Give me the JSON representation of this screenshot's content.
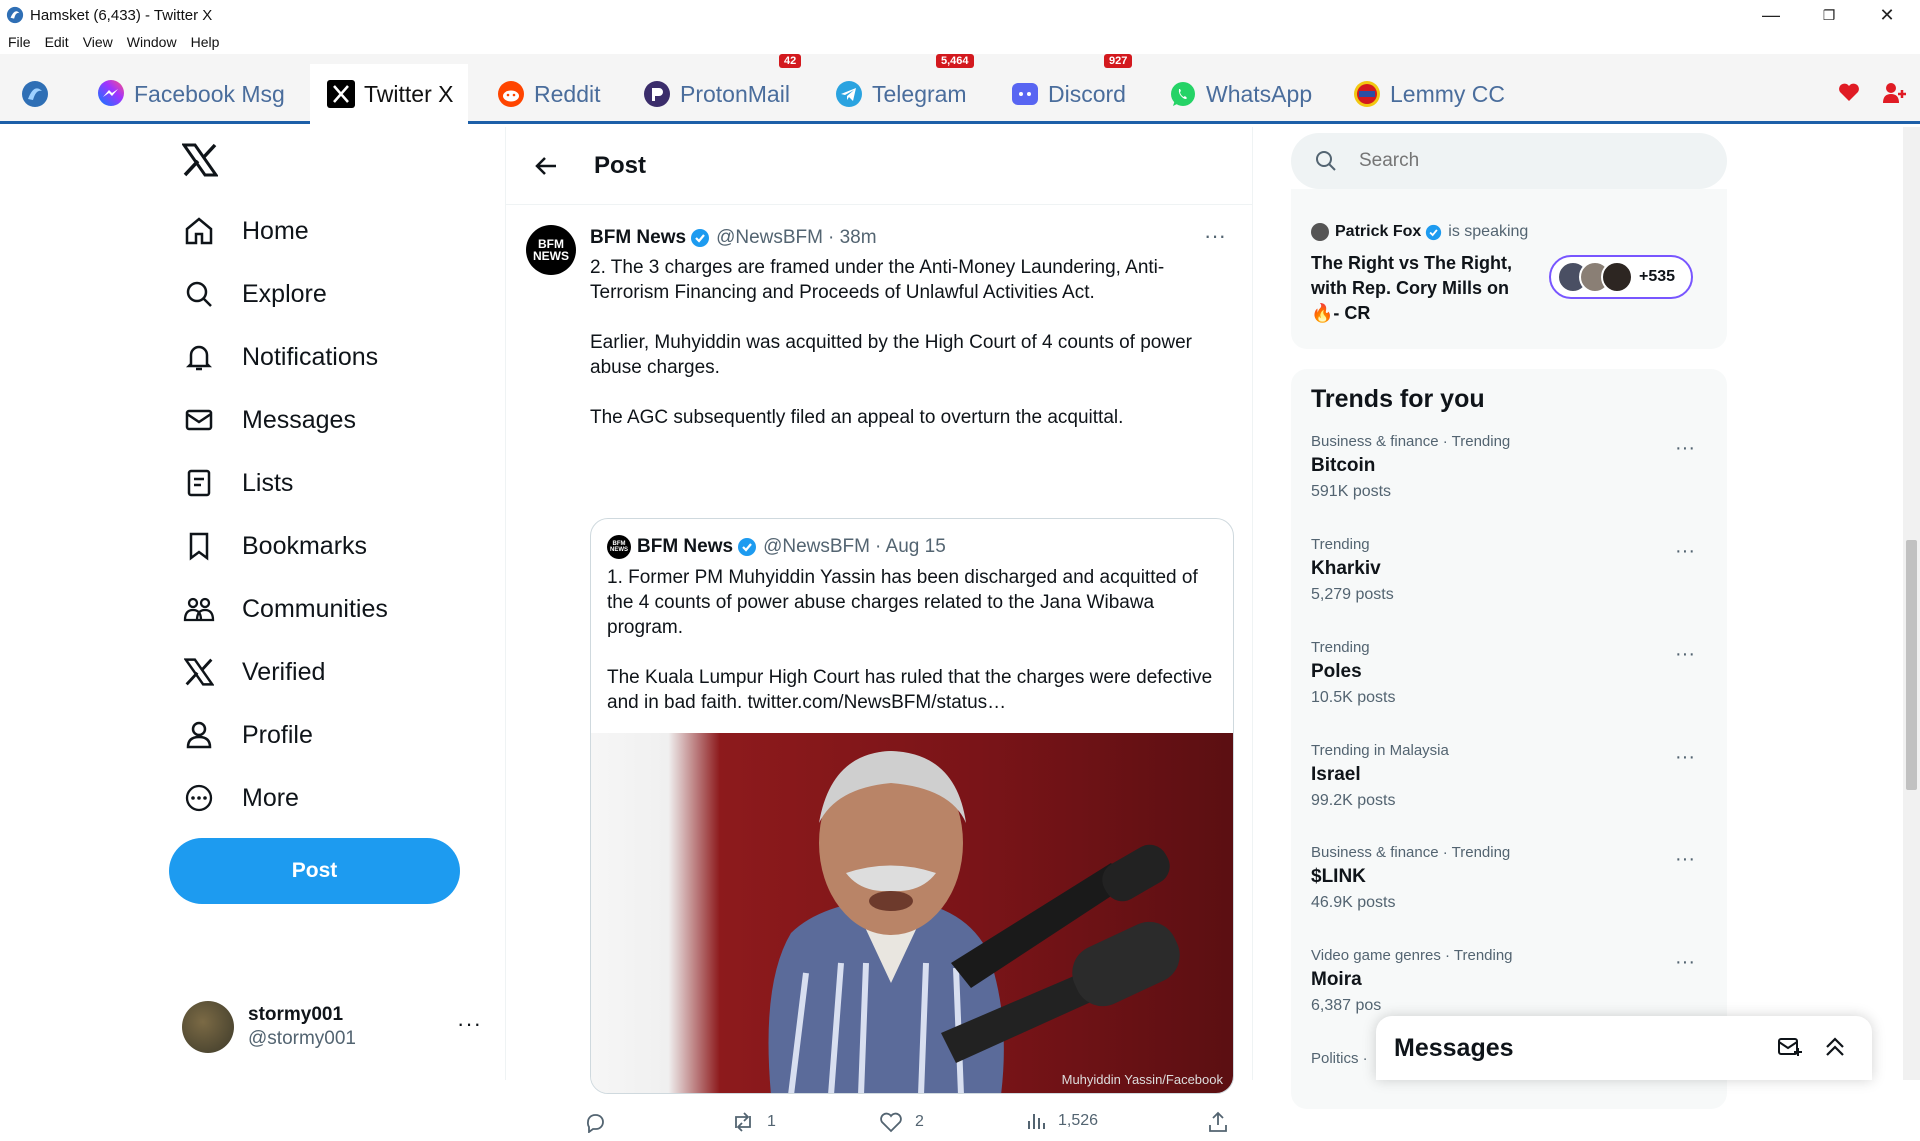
{
  "window": {
    "title": "Hamsket (6,433) - Twitter X",
    "controls": [
      "—",
      "❐",
      "✕"
    ]
  },
  "menu": [
    "File",
    "Edit",
    "View",
    "Window",
    "Help"
  ],
  "tabs": [
    {
      "label": "Facebook Msg",
      "badge": ""
    },
    {
      "label": "Twitter X",
      "badge": "",
      "active": true
    },
    {
      "label": "Reddit",
      "badge": ""
    },
    {
      "label": "ProtonMail",
      "badge": "42"
    },
    {
      "label": "Telegram",
      "badge": "5,464"
    },
    {
      "label": "Discord",
      "badge": "927"
    },
    {
      "label": "WhatsApp",
      "badge": ""
    },
    {
      "label": "Lemmy CC",
      "badge": ""
    }
  ],
  "nav": {
    "items": [
      "Home",
      "Explore",
      "Notifications",
      "Messages",
      "Lists",
      "Bookmarks",
      "Communities",
      "Verified",
      "Profile",
      "More"
    ],
    "post_label": "Post"
  },
  "account": {
    "name": "stormy001",
    "handle": "@stormy001",
    "more": "···"
  },
  "header": {
    "title": "Post"
  },
  "tweet": {
    "logo_text": "BFM NEWS",
    "name": "BFM News",
    "handle": "@NewsBFM",
    "time": "· 38m",
    "paragraphs": [
      "2. The 3 charges are framed under the Anti-Money Laundering, Anti-Terrorism Financing and Proceeds of Unlawful Activities Act.",
      "Earlier, Muhyiddin was acquitted by the High Court of 4 counts of power abuse charges.",
      "The AGC subsequently filed an appeal to overturn the acquittal."
    ],
    "more": "···",
    "quote": {
      "logo_text": "BFM NEWS",
      "name": "BFM News",
      "handle": "@NewsBFM",
      "time": "· Aug 15",
      "paragraphs": [
        "1. Former PM Muhyiddin Yassin has been discharged and acquitted of the 4 counts of power abuse charges related to the Jana Wibawa program.",
        "The Kuala Lumpur High Court has ruled that the charges were defective and in bad faith.  twitter.com/NewsBFM/status…"
      ],
      "image_caption": "Muhyiddin Yassin/Facebook"
    },
    "actions": {
      "reply": "",
      "retweets": "1",
      "likes": "2",
      "views": "1,526"
    }
  },
  "search": {
    "placeholder": "Search"
  },
  "space": {
    "host": "Patrick Fox",
    "status": "is speaking",
    "title": "The Right vs The Right, with Rep. Cory Mills on 🔥- CR",
    "listeners": "+535"
  },
  "trends": {
    "title": "Trends for you",
    "items": [
      {
        "meta": "Business & finance · Trending",
        "name": "Bitcoin",
        "count": "591K posts"
      },
      {
        "meta": "Trending",
        "name": "Kharkiv",
        "count": "5,279 posts"
      },
      {
        "meta": "Trending",
        "name": "Poles",
        "count": "10.5K posts"
      },
      {
        "meta": "Trending in Malaysia",
        "name": "Israel",
        "count": "99.2K posts"
      },
      {
        "meta": "Business & finance · Trending",
        "name": "$LINK",
        "count": "46.9K posts"
      },
      {
        "meta": "Video game genres · Trending",
        "name": "Moira",
        "count": "6,387 pos"
      },
      {
        "meta": "Politics ·",
        "name": "",
        "count": ""
      }
    ],
    "more": "···"
  },
  "messages_drawer": {
    "title": "Messages"
  },
  "colors": {
    "accent": "#1d9bf0",
    "tab_text": "#4a6d9c",
    "badge": "#d3191e",
    "tab_underline": "#1d5fa8"
  }
}
